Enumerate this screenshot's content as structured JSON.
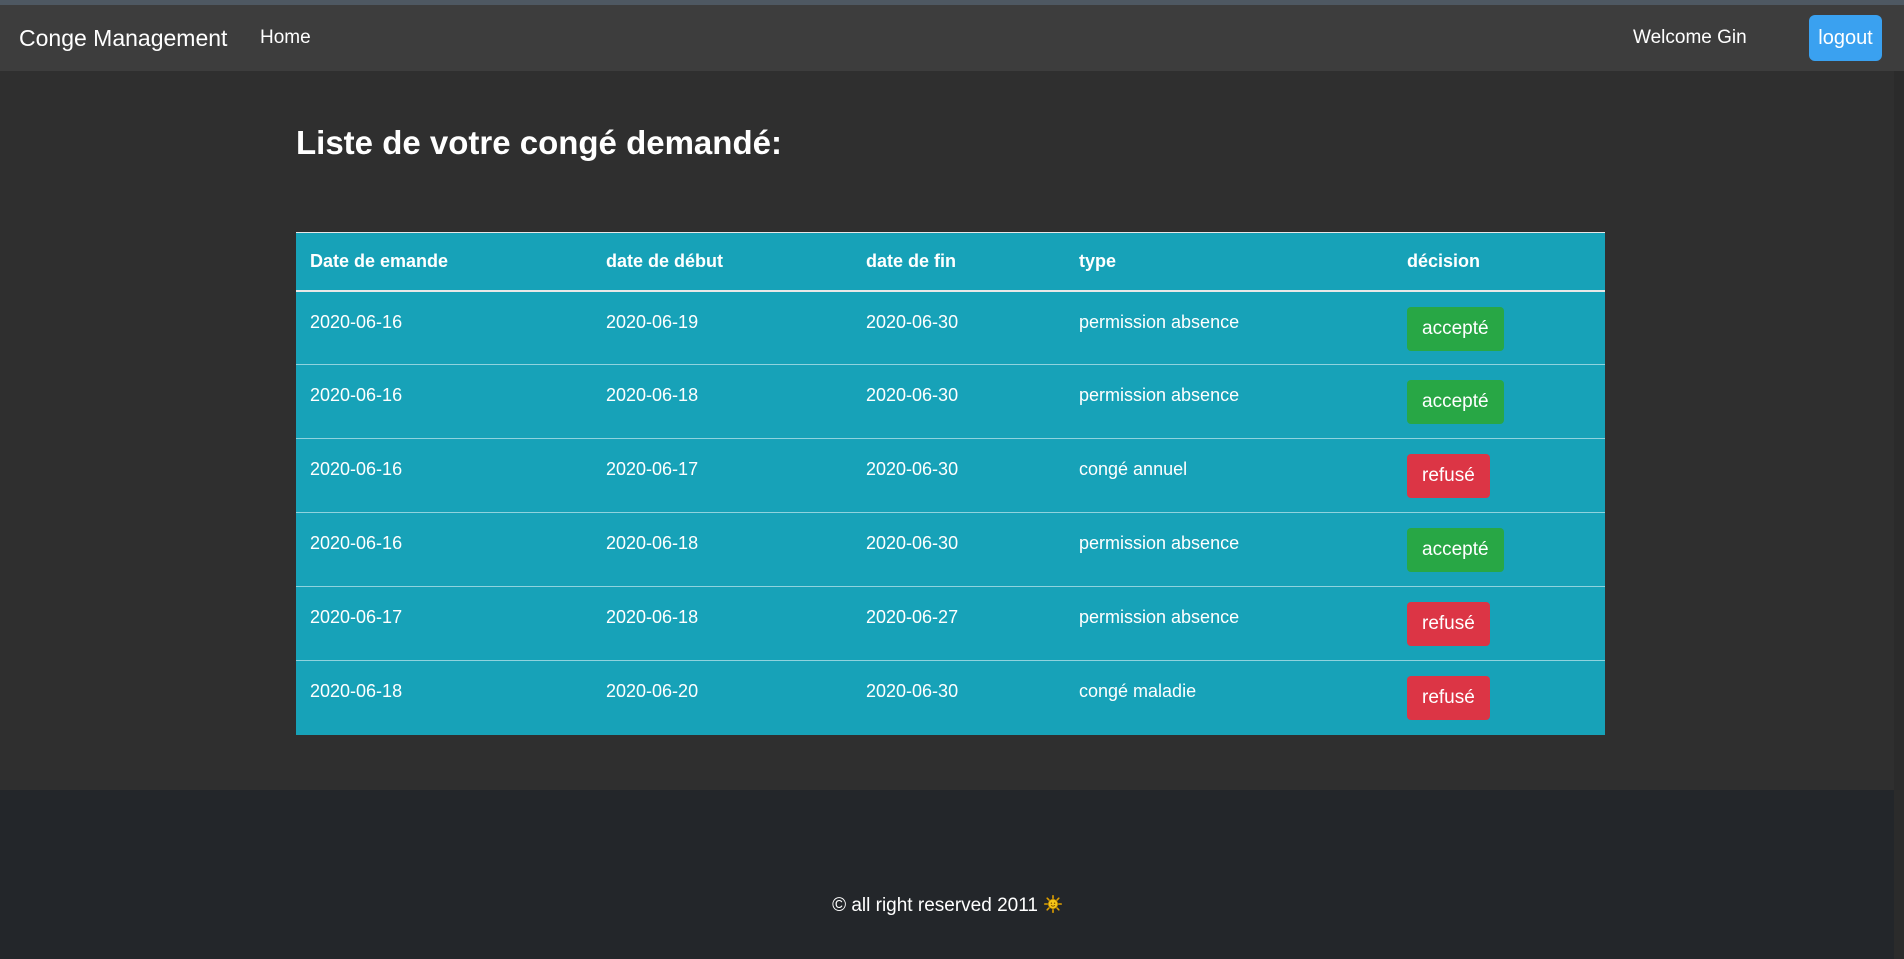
{
  "navbar": {
    "brand": "Conge Management",
    "home_link": "Home",
    "welcome": "Welcome Gin",
    "logout_label": "logout"
  },
  "main": {
    "title": "Liste de votre congé demandé:"
  },
  "table": {
    "headers": [
      "Date de emande",
      "date de début",
      "date de fin",
      "type",
      "décision"
    ],
    "rows": [
      {
        "date_demande": "2020-06-16",
        "date_debut": "2020-06-19",
        "date_fin": "2020-06-30",
        "type": "permission absence",
        "decision": "accepté"
      },
      {
        "date_demande": "2020-06-16",
        "date_debut": "2020-06-18",
        "date_fin": "2020-06-30",
        "type": "permission absence",
        "decision": "accepté"
      },
      {
        "date_demande": "2020-06-16",
        "date_debut": "2020-06-17",
        "date_fin": "2020-06-30",
        "type": "congé annuel",
        "decision": "refusé"
      },
      {
        "date_demande": "2020-06-16",
        "date_debut": "2020-06-18",
        "date_fin": "2020-06-30",
        "type": "permission absence",
        "decision": "accepté"
      },
      {
        "date_demande": "2020-06-17",
        "date_debut": "2020-06-18",
        "date_fin": "2020-06-27",
        "type": "permission absence",
        "decision": "refusé"
      },
      {
        "date_demande": "2020-06-18",
        "date_debut": "2020-06-20",
        "date_fin": "2020-06-30",
        "type": "congé maladie",
        "decision": "refusé"
      }
    ]
  },
  "footer": {
    "text": "© all right reserved 2011",
    "icon": "sun-icon"
  },
  "colors": {
    "navbar_bg": "#3d3d3d",
    "page_bg": "#2f2f2f",
    "table_bg": "#17a2b8",
    "accepted": "#28a745",
    "refused": "#dc3545",
    "logout_bg": "#3aa1f0",
    "footer_bg": "#23262a"
  }
}
